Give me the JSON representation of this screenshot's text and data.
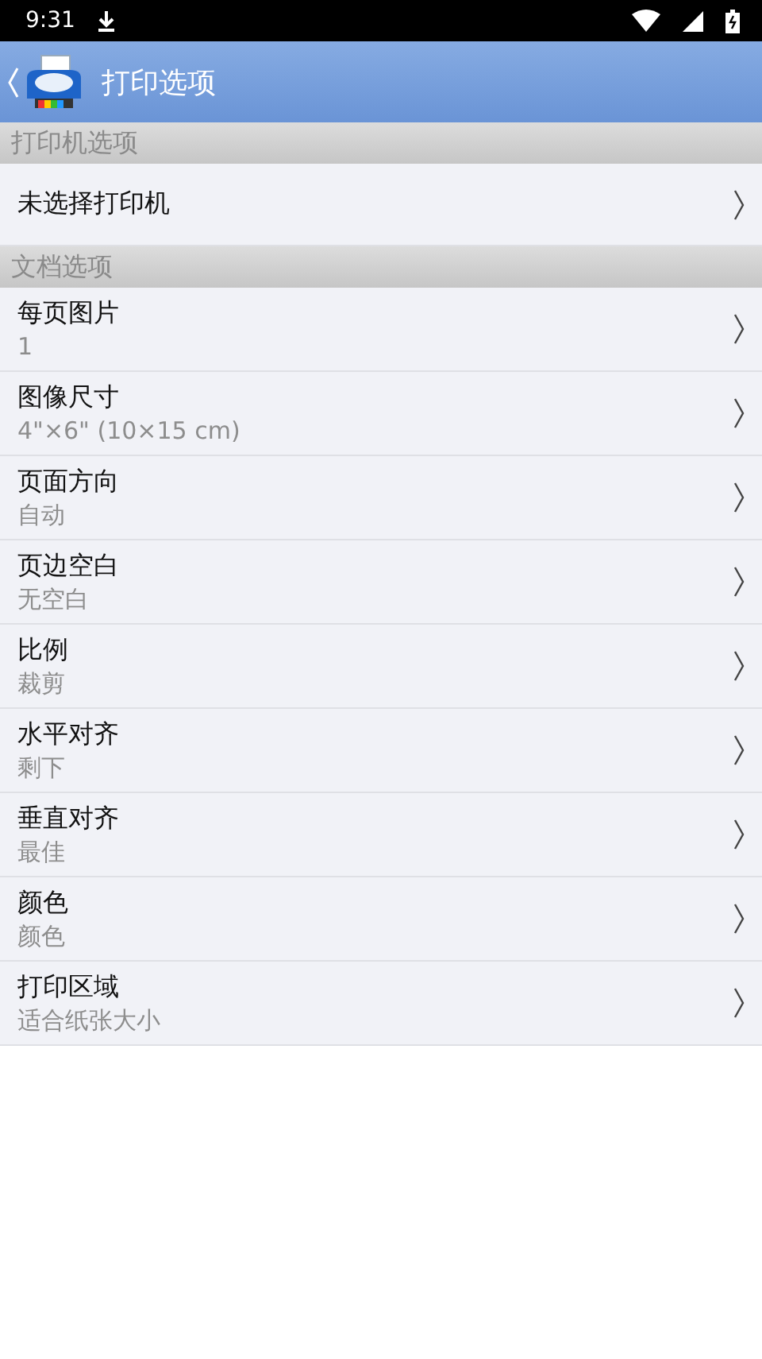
{
  "status_bar": {
    "time": "9:31"
  },
  "header": {
    "title": "打印选项"
  },
  "sections": [
    {
      "title": "打印机选项",
      "items": [
        {
          "label": "未选择打印机"
        }
      ]
    },
    {
      "title": "文档选项",
      "items": [
        {
          "label": "每页图片",
          "value": "1"
        },
        {
          "label": "图像尺寸",
          "value": "4\"×6\" (10×15 cm)"
        },
        {
          "label": "页面方向",
          "value": "自动"
        },
        {
          "label": "页边空白",
          "value": "无空白"
        },
        {
          "label": "比例",
          "value": "裁剪"
        },
        {
          "label": "水平对齐",
          "value": "剩下"
        },
        {
          "label": "垂直对齐",
          "value": "最佳"
        },
        {
          "label": "颜色",
          "value": "颜色"
        },
        {
          "label": "打印区域",
          "value": "适合纸张大小"
        }
      ]
    }
  ]
}
